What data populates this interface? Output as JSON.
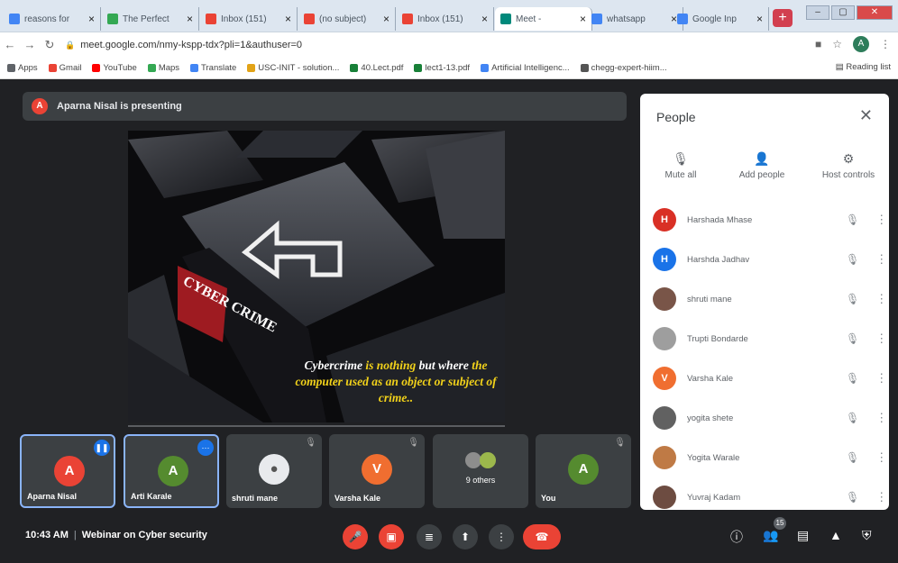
{
  "browser": {
    "tabs": [
      {
        "title": "reasons for",
        "favicon_color": "#4285f4"
      },
      {
        "title": "The Perfect",
        "favicon_color": "#34a853"
      },
      {
        "title": "Inbox (151)",
        "favicon_color": "#ea4335"
      },
      {
        "title": "(no subject)",
        "favicon_color": "#ea4335"
      },
      {
        "title": "Inbox (151)",
        "favicon_color": "#ea4335"
      },
      {
        "title": "Meet -",
        "favicon_color": "#00897b"
      },
      {
        "title": "whatsapp",
        "favicon_color": "#4285f4"
      },
      {
        "title": "Google Inp",
        "favicon_color": "#4285f4"
      }
    ],
    "url": "meet.google.com/nmy-kspp-tdx?pli=1&authuser=0",
    "bookmarks": [
      "Apps",
      "Gmail",
      "YouTube",
      "Maps",
      "Translate",
      "USC-INIT - solution...",
      "40.Lect.pdf",
      "lect1-13.pdf",
      "Artificial Intelligenc...",
      "chegg-expert-hiim..."
    ],
    "reading_list": "Reading list",
    "profile_initial": "A"
  },
  "meet": {
    "presenting": {
      "name": "Aparna Nisal is presenting",
      "initial": "A"
    },
    "slide": {
      "keyboard_text": "CYBER CRIME",
      "caption_parts": [
        {
          "text": "Cybercrime",
          "style": "white"
        },
        {
          "text": " is nothing ",
          "style": "yellow"
        },
        {
          "text": "but where",
          "style": "white"
        },
        {
          "text": " the computer used as an object",
          "style": "yellow"
        },
        {
          "text": " or subject of crime..",
          "style": "yellow"
        }
      ]
    },
    "tiles": [
      {
        "name": "Aparna Nisal",
        "initial": "A",
        "color": "#ea4335",
        "highlight": true,
        "badge": "talking"
      },
      {
        "name": "Arti Karale",
        "initial": "A",
        "color": "#558b2f",
        "highlight": true,
        "badge": "more"
      },
      {
        "name": "shruti mane",
        "initial": "",
        "color": "#e8eaed",
        "highlight": false,
        "badge": "muted"
      },
      {
        "name": "Varsha Kale",
        "initial": "V",
        "color": "#f06e30",
        "highlight": false,
        "badge": "muted"
      },
      {
        "name": "9 others",
        "initial": "",
        "color": "#3c4043",
        "highlight": false,
        "badge": "none"
      },
      {
        "name": "You",
        "initial": "A",
        "color": "#558b2f",
        "highlight": false,
        "badge": "muted"
      }
    ],
    "time": "10:43 AM",
    "meeting_name": "Webinar on Cyber security",
    "participants_count": "15"
  },
  "people_panel": {
    "title": "People",
    "actions": [
      {
        "label": "Mute all",
        "icon": "mic-off-icon"
      },
      {
        "label": "Add people",
        "icon": "add-person-icon"
      },
      {
        "label": "Host controls",
        "icon": "toggle-icon"
      }
    ],
    "people": [
      {
        "name": "Harshada Mhase",
        "initial": "H",
        "color": "#d93025"
      },
      {
        "name": "Harshda Jadhav",
        "initial": "H",
        "color": "#1a73e8"
      },
      {
        "name": "shruti mane",
        "initial": "",
        "color": "#795548"
      },
      {
        "name": "Trupti Bondarde",
        "initial": "",
        "color": "#9e9e9e"
      },
      {
        "name": "Varsha Kale",
        "initial": "V",
        "color": "#f06e30"
      },
      {
        "name": "yogita shete",
        "initial": "",
        "color": "#616161"
      },
      {
        "name": "Yogita Warale",
        "initial": "",
        "color": "#bf7a45"
      },
      {
        "name": "Yuvraj Kadam",
        "initial": "",
        "color": "#6d4c41"
      }
    ]
  }
}
